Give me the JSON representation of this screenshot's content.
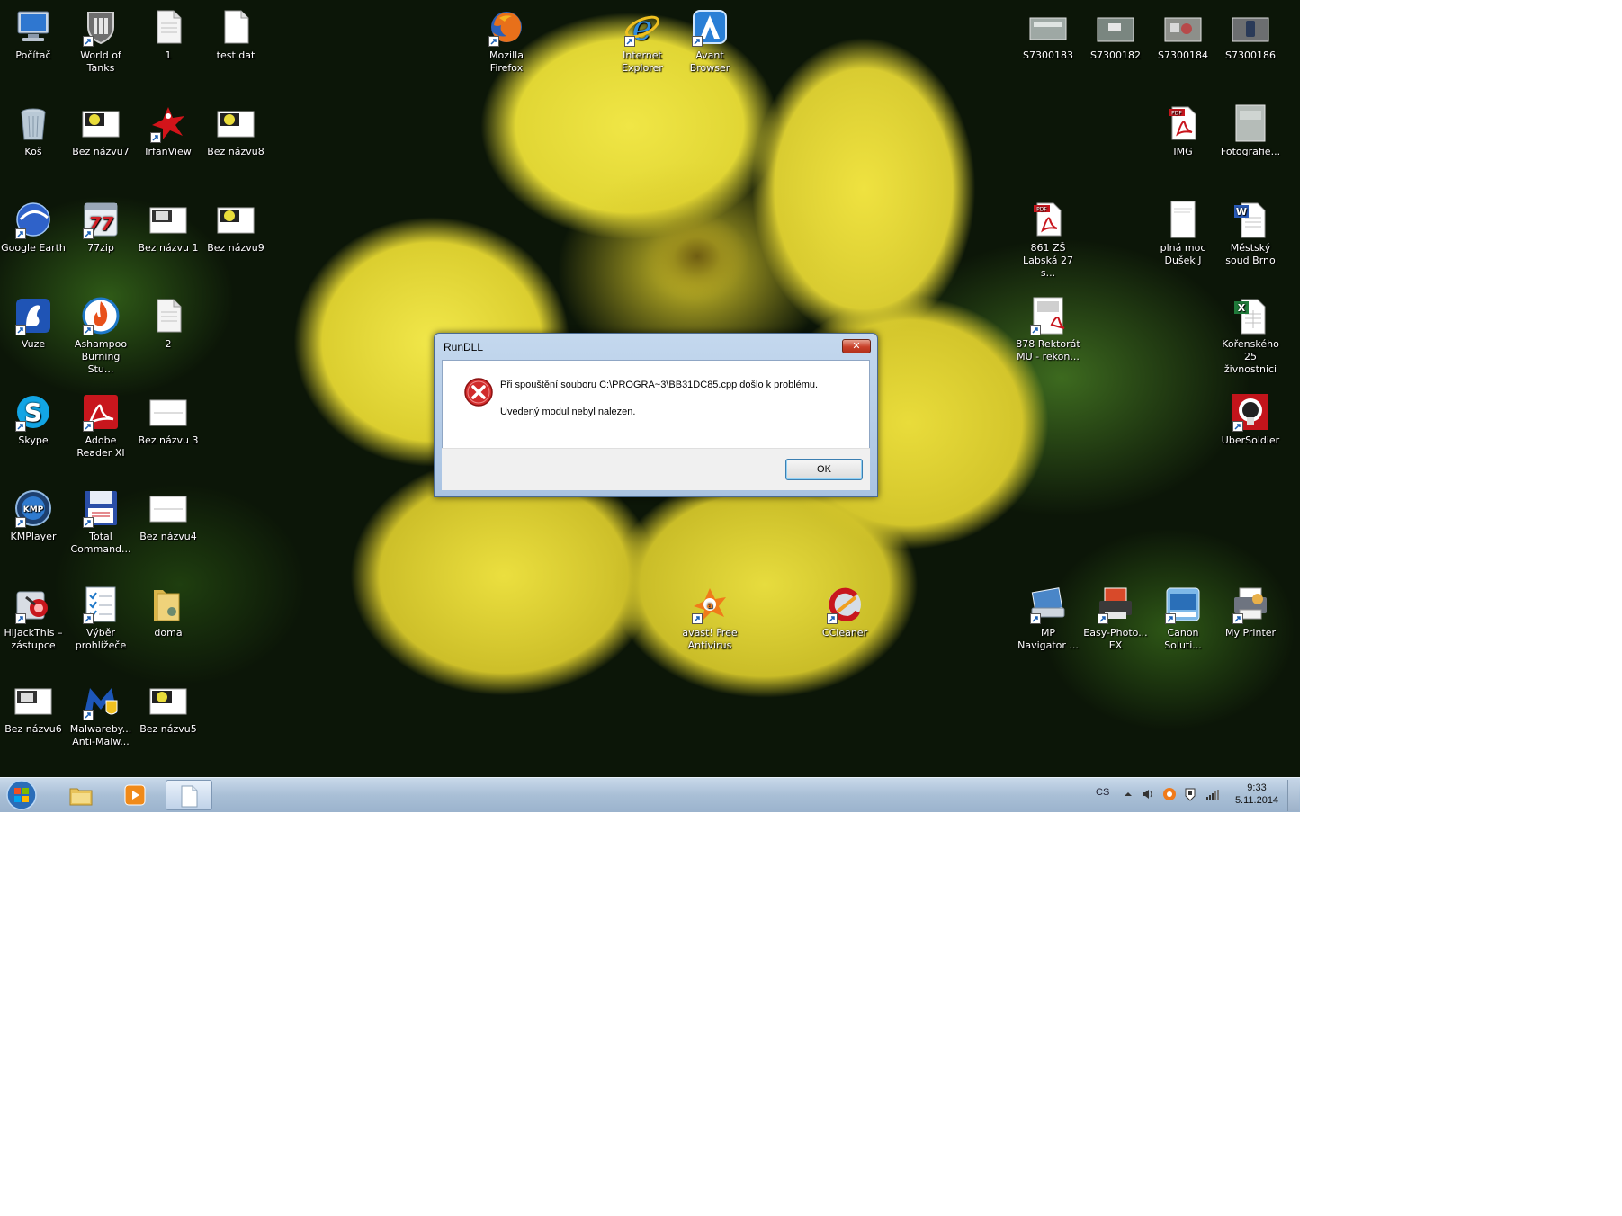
{
  "desktop": {
    "icons": [
      {
        "label": "Počítač",
        "icon": "computer-icon"
      },
      {
        "label": "World of Tanks",
        "icon": "game-icon"
      },
      {
        "label": "1",
        "icon": "file-icon"
      },
      {
        "label": "test.dat",
        "icon": "file-icon"
      },
      {
        "label": "Mozilla Firefox",
        "icon": "firefox-icon"
      },
      {
        "label": "Internet Explorer",
        "icon": "ie-icon"
      },
      {
        "label": "Avant Browser",
        "icon": "avant-icon"
      },
      {
        "label": "S7300183",
        "icon": "photo-icon"
      },
      {
        "label": "S7300182",
        "icon": "photo-icon"
      },
      {
        "label": "S7300184",
        "icon": "photo-icon"
      },
      {
        "label": "S7300186",
        "icon": "photo-icon"
      },
      {
        "label": "Koš",
        "icon": "recycle-bin-icon"
      },
      {
        "label": "Bez názvu7",
        "icon": "image-thumb-icon"
      },
      {
        "label": "IrfanView",
        "icon": "irfanview-icon"
      },
      {
        "label": "Bez názvu8",
        "icon": "image-thumb-icon"
      },
      {
        "label": "IMG",
        "icon": "pdf-icon"
      },
      {
        "label": "Fotografie...",
        "icon": "photo-icon"
      },
      {
        "label": "Google Earth",
        "icon": "google-earth-icon"
      },
      {
        "label": "77zip",
        "icon": "archive-icon"
      },
      {
        "label": "Bez názvu 1",
        "icon": "image-thumb-icon"
      },
      {
        "label": "Bez názvu9",
        "icon": "image-thumb-icon"
      },
      {
        "label": "861 ZŠ Labská 27 s...",
        "icon": "pdf-icon"
      },
      {
        "label": "plná moc Dušek J",
        "icon": "document-icon"
      },
      {
        "label": "Městský soud Brno",
        "icon": "word-icon"
      },
      {
        "label": "Vuze",
        "icon": "vuze-icon"
      },
      {
        "label": "Ashampoo Burning Stu...",
        "icon": "ashampoo-icon"
      },
      {
        "label": "2",
        "icon": "file-icon"
      },
      {
        "label": "878 Rektorát MU - rekon...",
        "icon": "pdf-icon"
      },
      {
        "label": "Kořenského 25 živnostnici",
        "icon": "excel-icon"
      },
      {
        "label": "Skype",
        "icon": "skype-icon"
      },
      {
        "label": "Adobe Reader XI",
        "icon": "adobe-reader-icon"
      },
      {
        "label": "Bez názvu 3",
        "icon": "image-thumb-icon"
      },
      {
        "label": "UberSoldier",
        "icon": "game-icon"
      },
      {
        "label": "KMPlayer",
        "icon": "kmplayer-icon"
      },
      {
        "label": "Total Command...",
        "icon": "total-commander-icon"
      },
      {
        "label": "Bez názvu4",
        "icon": "image-thumb-icon"
      },
      {
        "label": "HijackThis – zástupce",
        "icon": "hijackthis-icon"
      },
      {
        "label": "Výběr prohlížeče",
        "icon": "checklist-icon"
      },
      {
        "label": "doma",
        "icon": "folder-icon"
      },
      {
        "label": "avast! Free Antivirus",
        "icon": "avast-icon"
      },
      {
        "label": "CCleaner",
        "icon": "ccleaner-icon"
      },
      {
        "label": "MP Navigator ...",
        "icon": "scanner-icon"
      },
      {
        "label": "Easy-Photo... EX",
        "icon": "printer-icon"
      },
      {
        "label": "Canon Soluti...",
        "icon": "canon-icon"
      },
      {
        "label": "My Printer",
        "icon": "printer-icon"
      },
      {
        "label": "Bez názvu6",
        "icon": "image-thumb-icon"
      },
      {
        "label": "Malwareby... Anti-Malw...",
        "icon": "malwarebytes-icon"
      },
      {
        "label": "Bez názvu5",
        "icon": "image-thumb-icon"
      }
    ]
  },
  "dialog": {
    "title": "RunDLL",
    "close_label": "✕",
    "message_line1": "Při spouštění souboru C:\\PROGRA~3\\BB31DC85.cpp došlo k problému.",
    "message_line2": "Uvedený modul nebyl nalezen.",
    "ok_label": "OK",
    "icon": "error-icon"
  },
  "taskbar": {
    "start": "windows-start-icon",
    "pinned": [
      "explorer-icon",
      "media-player-icon",
      "notepad-icon"
    ],
    "language": "CS",
    "time": "9:33",
    "date": "5.11.2014"
  },
  "colors": {
    "taskbar": "#a9bfd6",
    "dialog_frame": "#b8cfe9",
    "error_red": "#d12b2b"
  }
}
